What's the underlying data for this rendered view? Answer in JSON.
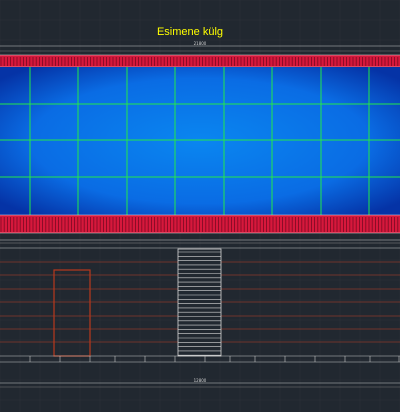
{
  "drawing": {
    "title": "Esimene külg",
    "dimension_top": "21800",
    "dimension_bottom": "12800"
  },
  "colors": {
    "background": "#212830",
    "grid": "#2c333b",
    "panel_light": "#0a86f0",
    "panel_dark": "#0533a6",
    "panel_grid": "#22e84a",
    "red_trim": "#d6183c",
    "window_frame": "#b8381c",
    "siding": "#8a3a2a",
    "stair": "#d8d8d8",
    "dim_line": "#c8c8c8",
    "title": "#ffff00"
  },
  "icons": {
    "door": "door-outline-icon",
    "stair": "staircase-icon"
  }
}
